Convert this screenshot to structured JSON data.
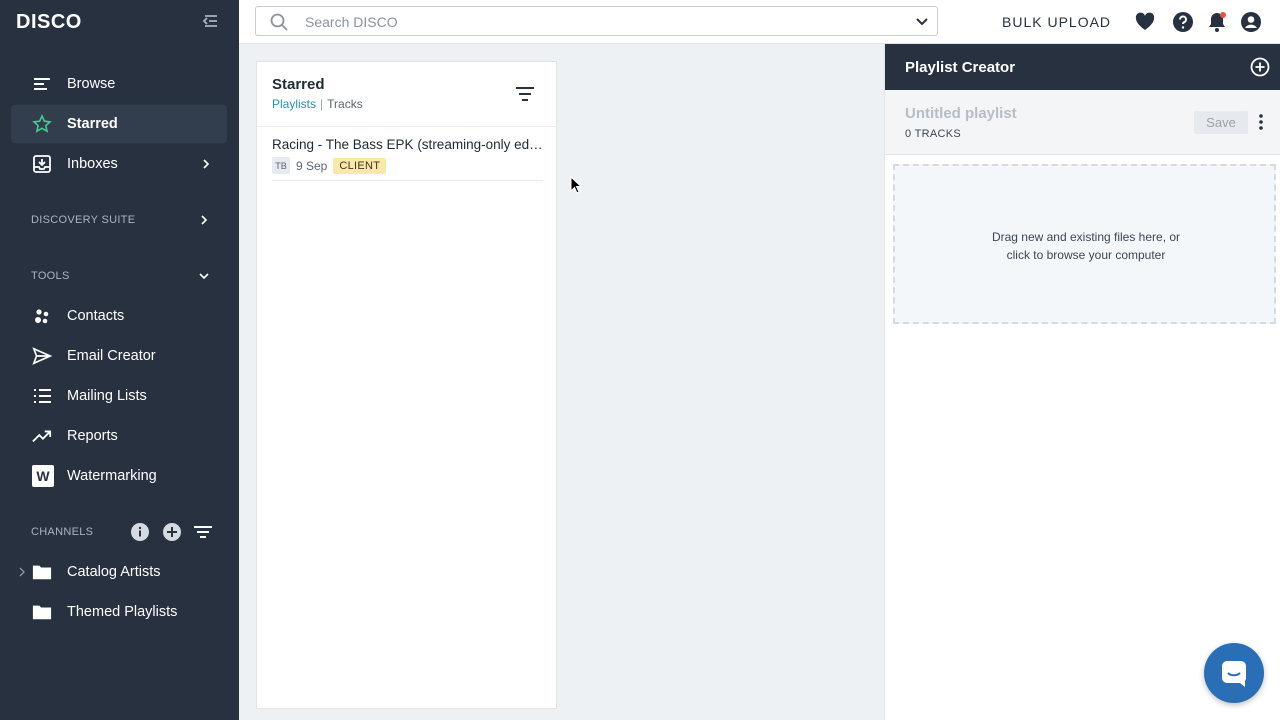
{
  "app": {
    "logo": "DISCO"
  },
  "sidebar": {
    "items": [
      {
        "label": "Browse",
        "icon": "browse-icon"
      },
      {
        "label": "Starred",
        "icon": "star-icon"
      },
      {
        "label": "Inboxes",
        "icon": "inbox-icon"
      }
    ],
    "discovery_label": "DISCOVERY SUITE",
    "tools_label": "TOOLS",
    "tools": [
      {
        "label": "Contacts",
        "icon": "contacts-icon"
      },
      {
        "label": "Email Creator",
        "icon": "send-icon"
      },
      {
        "label": "Mailing Lists",
        "icon": "list-icon"
      },
      {
        "label": "Reports",
        "icon": "trend-icon"
      },
      {
        "label": "Watermarking",
        "icon": "watermark-icon",
        "glyph": "W"
      }
    ],
    "channels_label": "CHANNELS",
    "channels": [
      {
        "label": "Catalog Artists",
        "icon": "folder-icon"
      },
      {
        "label": "Themed Playlists",
        "icon": "folder-icon"
      }
    ]
  },
  "topbar": {
    "search_placeholder": "Search DISCO",
    "bulk_upload": "BULK UPLOAD"
  },
  "starred": {
    "title": "Starred",
    "tab_playlists": "Playlists",
    "tab_separator": "|",
    "tab_tracks": "Tracks",
    "rows": [
      {
        "title": "Racing - The Bass EPK (streaming-only edition)",
        "initials": "TB",
        "date": "9 Sep",
        "badge": "CLIENT"
      }
    ]
  },
  "playlist_creator": {
    "title": "Playlist Creator",
    "playlist_name": "Untitled playlist",
    "track_count": "0 TRACKS",
    "save_label": "Save",
    "drop_line1": "Drag new and existing files here, or",
    "drop_line2": "click to browse your computer"
  },
  "colors": {
    "sidebar_bg": "#273140",
    "accent_link": "#2c8fb3",
    "star_green": "#3ecf8e",
    "badge_bg": "#fbe7a7",
    "chat_blue": "#2a6fb6"
  }
}
